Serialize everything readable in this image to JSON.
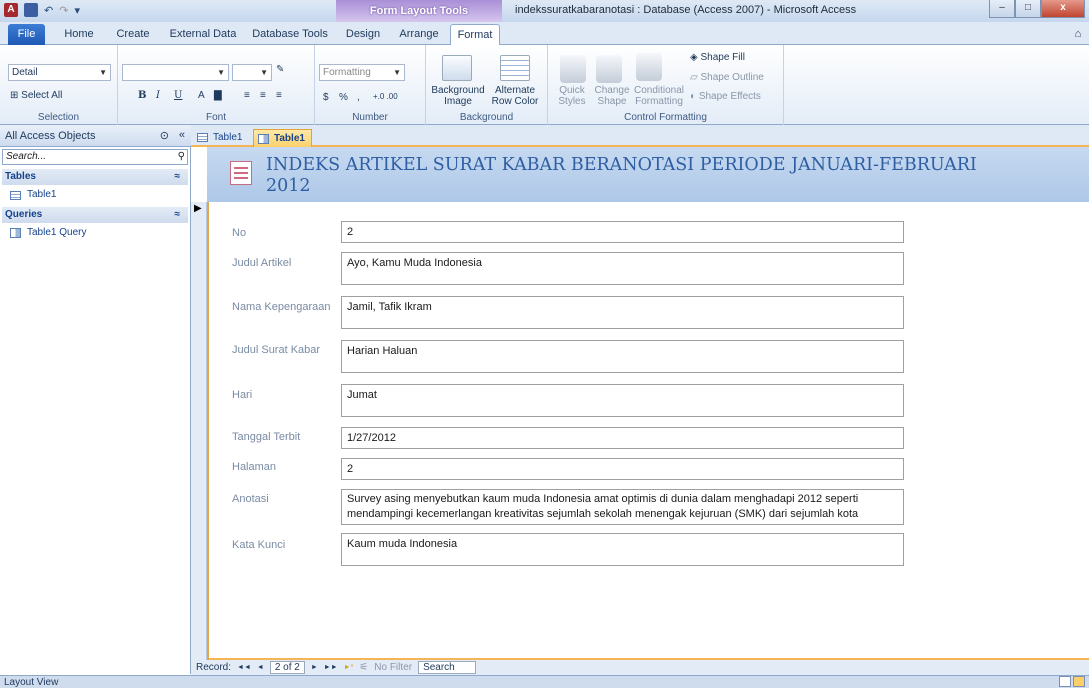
{
  "window": {
    "title": "indekssuratkabaranotasi : Database (Access 2007)  -  Microsoft Access",
    "context_tools": "Form Layout Tools",
    "minimize": "–",
    "maximize": "□",
    "close": "x"
  },
  "ribbon_tabs": [
    "File",
    "Home",
    "Create",
    "External Data",
    "Database Tools",
    "Design",
    "Arrange",
    "Format"
  ],
  "ribbon": {
    "selection": {
      "object": "Detail",
      "select_all": "Select All",
      "label": "Selection"
    },
    "font": {
      "label": "Font",
      "bold": "B",
      "italic": "I",
      "underline": "U",
      "font_color": "A"
    },
    "number": {
      "format": "Formatting",
      "currency": "$",
      "percent": "%",
      "comma": ",",
      "inc_dec": "+.0 .00",
      "label": "Number"
    },
    "background": {
      "background_image": "Background Image",
      "alternate_row_color": "Alternate Row Color",
      "label": "Background"
    },
    "control_formatting": {
      "quick_styles": "Quick Styles",
      "change_shape": "Change Shape",
      "conditional_formatting": "Conditional Formatting",
      "shape_fill": "Shape Fill",
      "shape_outline": "Shape Outline",
      "shape_effects": "Shape Effects",
      "label": "Control Formatting"
    }
  },
  "nav": {
    "title": "All Access Objects",
    "search_placeholder": "Search...",
    "sections": [
      {
        "name": "Tables",
        "items": [
          "Table1"
        ]
      },
      {
        "name": "Queries",
        "items": [
          "Table1 Query"
        ]
      }
    ]
  },
  "doc_tabs": [
    "Table1",
    "Table1"
  ],
  "form": {
    "title": "INDEKS ARTIKEL SURAT KABAR BERANOTASI PERIODE JANUARI-FEBRUARI 2012",
    "fields": [
      {
        "label": "No",
        "value": "2"
      },
      {
        "label": "Judul Artikel",
        "value": "Ayo, Kamu Muda Indonesia"
      },
      {
        "label": "Nama Kepengaraan",
        "value": "Jamil, Tafik Ikram"
      },
      {
        "label": "Judul Surat Kabar",
        "value": "Harian Haluan"
      },
      {
        "label": "Hari",
        "value": "Jumat"
      },
      {
        "label": "Tanggal Terbit",
        "value": "1/27/2012"
      },
      {
        "label": "Halaman",
        "value": "2"
      },
      {
        "label": "Anotasi",
        "value": "Survey asing menyebutkan kaum muda Indonesia amat optimis di dunia dalam menghadapi 2012 seperti mendampingi kecemerlangan kreativitas sejumlah sekolah menengak kejuruan (SMK) dari sejumlah kota"
      },
      {
        "label": "Kata Kunci",
        "value": "Kaum muda Indonesia"
      }
    ]
  },
  "record_nav": {
    "label": "Record:",
    "first": "◄◄",
    "prev": "◄",
    "current": "2 of 2",
    "next": "►",
    "last": "►►",
    "new": "►*",
    "filter": "No Filter",
    "search": "Search"
  },
  "status": {
    "view": "Layout View"
  }
}
